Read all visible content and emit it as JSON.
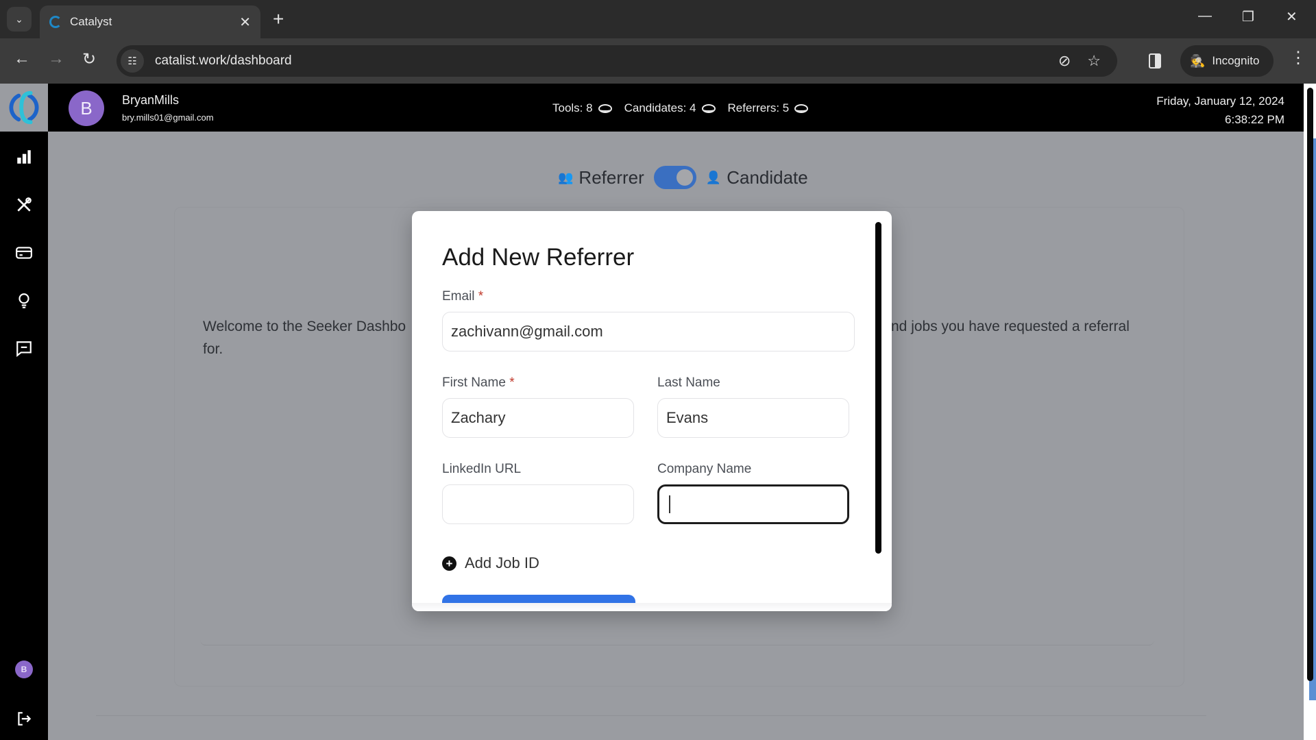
{
  "browser": {
    "tab_title": "Catalyst",
    "url": "catalist.work/dashboard",
    "incognito_label": "Incognito"
  },
  "user": {
    "name": "BryanMills",
    "email": "bry.mills01@gmail.com",
    "initial": "B"
  },
  "stats": [
    {
      "label": "Tools: 8"
    },
    {
      "label": "Candidates: 4"
    },
    {
      "label": "Referrers: 5"
    }
  ],
  "datetime": {
    "date": "Friday, January 12, 2024",
    "time": "6:38:22 PM"
  },
  "sidebar": {
    "items": [
      {
        "name": "dashboard",
        "icon": "bar-chart-icon"
      },
      {
        "name": "tools",
        "icon": "tools-icon"
      },
      {
        "name": "billing",
        "icon": "credit-card-icon"
      },
      {
        "name": "ideas",
        "icon": "lightbulb-icon"
      },
      {
        "name": "messages",
        "icon": "message-icon"
      }
    ],
    "avatar_initial": "B"
  },
  "toggle": {
    "left_label": "Referrer",
    "right_label": "Candidate",
    "active": "Candidate"
  },
  "main": {
    "welcome_left": "Welcome to the Seeker Dashbo",
    "welcome_right": "nd jobs you have requested a referral",
    "welcome_second_line": "for."
  },
  "modal": {
    "title": "Add New Referrer",
    "fields": {
      "email": {
        "label": "Email",
        "required": "*",
        "value": "zachivann@gmail.com"
      },
      "first_name": {
        "label": "First Name",
        "required": "*",
        "value": "Zachary"
      },
      "last_name": {
        "label": "Last Name",
        "value": "Evans"
      },
      "linkedin": {
        "label": "LinkedIn URL",
        "value": ""
      },
      "company": {
        "label": "Company Name",
        "value": ""
      }
    },
    "add_job_label": "Add Job ID"
  },
  "colors": {
    "accent": "#3173e6",
    "avatar": "#8a67c9",
    "toggle": "#3a6fc1"
  }
}
